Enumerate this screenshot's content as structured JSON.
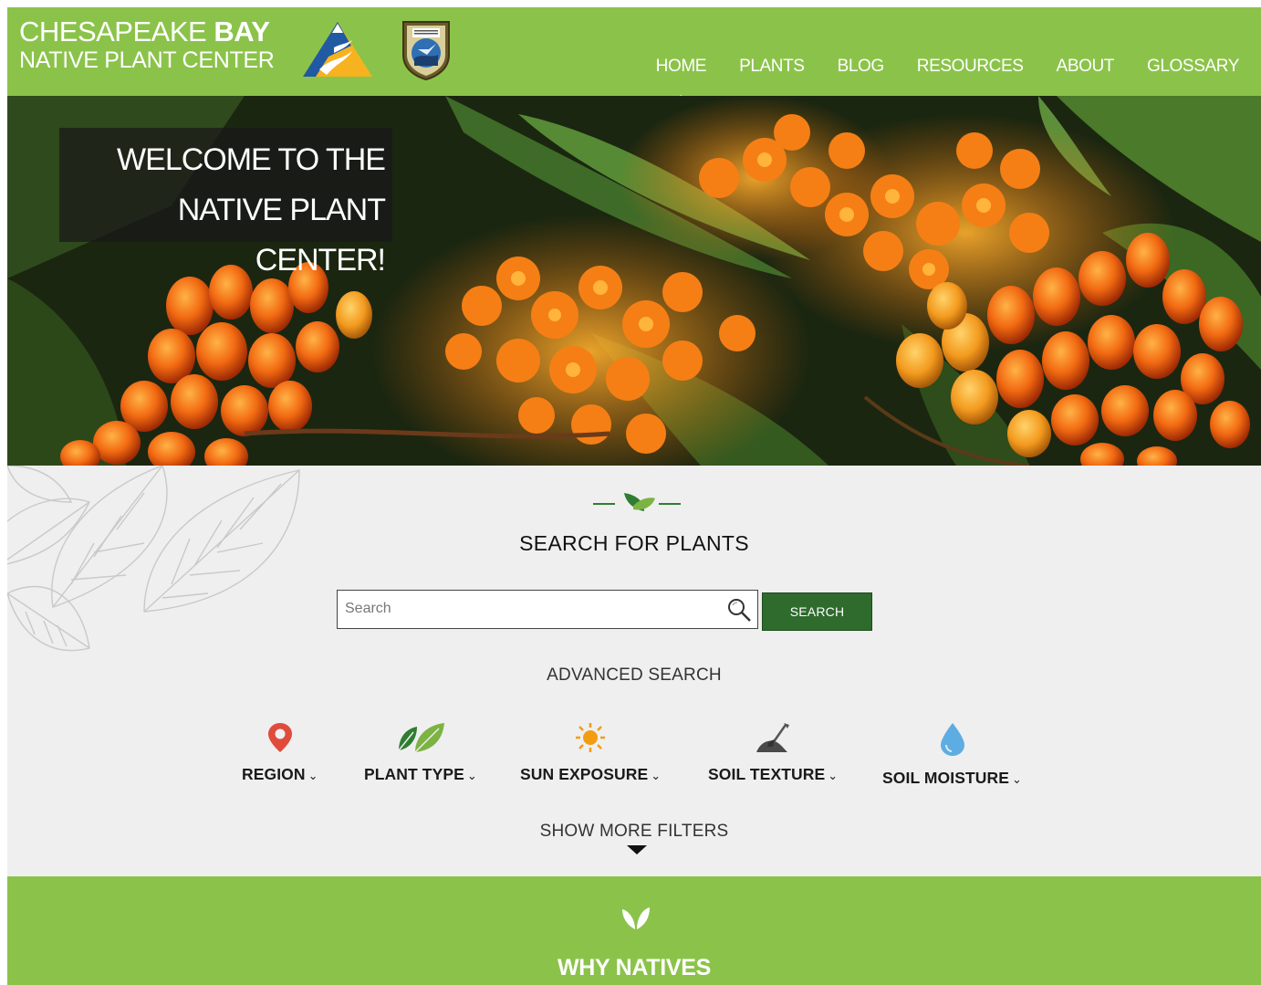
{
  "header": {
    "brand_line1_a": "CHESAPEAKE",
    "brand_line1_b": "BAY",
    "brand_line2": "NATIVE PLANT CENTER",
    "nav": [
      {
        "label": "HOME",
        "active": true
      },
      {
        "label": "PLANTS"
      },
      {
        "label": "BLOG"
      },
      {
        "label": "RESOURCES"
      },
      {
        "label": "ABOUT"
      },
      {
        "label": "GLOSSARY"
      }
    ]
  },
  "hero": {
    "welcome_line1": "WELCOME TO THE",
    "welcome_line2": "NATIVE PLANT CENTER!"
  },
  "search": {
    "title": "SEARCH FOR PLANTS",
    "placeholder": "Search",
    "button_label": "SEARCH",
    "advanced_label": "ADVANCED SEARCH",
    "filters": [
      {
        "label": "REGION",
        "icon": "map-pin-icon"
      },
      {
        "label": "PLANT TYPE",
        "icon": "leaves-icon"
      },
      {
        "label": "SUN EXPOSURE",
        "icon": "sun-icon"
      },
      {
        "label": "SOIL TEXTURE",
        "icon": "shovel-icon"
      },
      {
        "label": "SOIL MOISTURE",
        "icon": "water-drop-icon"
      }
    ],
    "show_more_label": "SHOW MORE FILTERS"
  },
  "why": {
    "title": "WHY NATIVES"
  },
  "colors": {
    "header_green": "#8bc34a",
    "button_green": "#2e6b2d",
    "section_bg": "#efefef"
  }
}
